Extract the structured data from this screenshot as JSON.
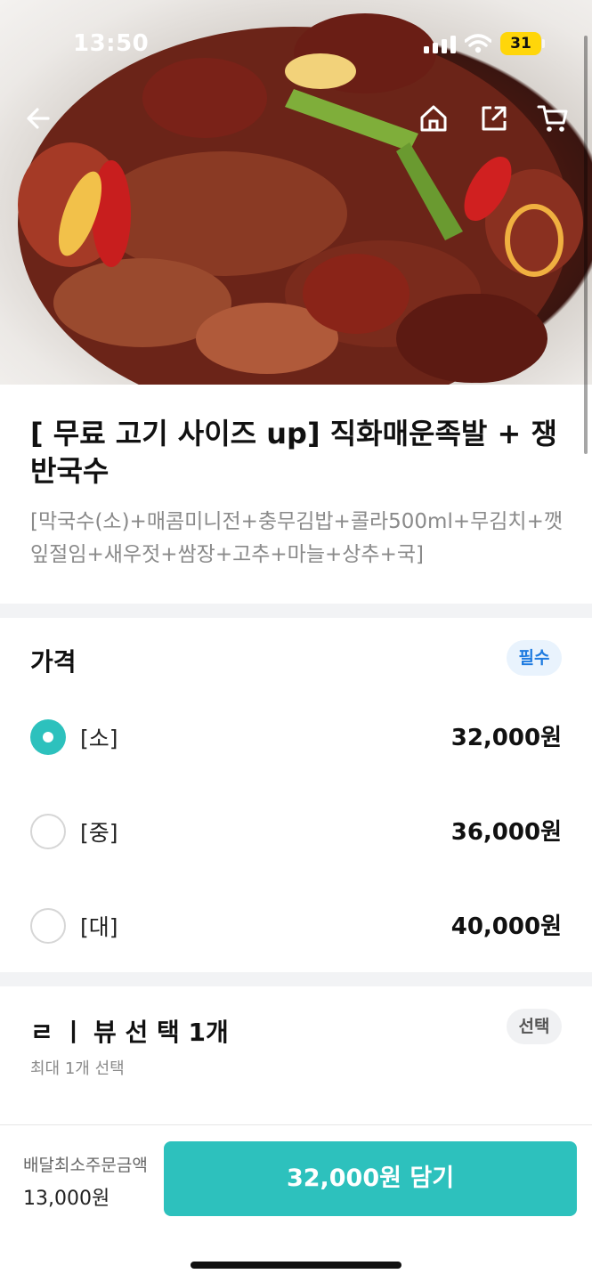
{
  "status_bar": {
    "time": "13:50",
    "battery": "31",
    "icons": [
      "signal-icon",
      "wifi-icon",
      "battery-icon"
    ]
  },
  "header": {
    "icons": [
      "back-arrow-icon",
      "home-icon",
      "share-icon",
      "cart-icon"
    ]
  },
  "product": {
    "title": "[ 무료 고기 사이즈 up] 직화매운족발 + 쟁반국수",
    "description": "[막국수(소)+매콤미니전+충무김밥+콜라500ml+무김치+깻잎절임+새우젓+쌈장+고추+마늘+상추+국]"
  },
  "price_group": {
    "title": "가격",
    "badge": "필수",
    "options": [
      {
        "label": "[소]",
        "price": "32,000원",
        "selected": true
      },
      {
        "label": "[중]",
        "price": "36,000원",
        "selected": false
      },
      {
        "label": "[대]",
        "price": "40,000원",
        "selected": false
      }
    ]
  },
  "choice_group": {
    "title": "ㄹ ㅣ 뷰 선 택 1개",
    "subtitle": "최대 1개 선택",
    "badge": "선택"
  },
  "bottom_bar": {
    "min_order_label": "배달최소주문금액",
    "min_order_value": "13,000원",
    "cart_button": "32,000원 담기"
  },
  "colors": {
    "accent": "#2dc1bd",
    "required_badge_text": "#1e7be0",
    "required_badge_bg": "#e9f3fd"
  }
}
